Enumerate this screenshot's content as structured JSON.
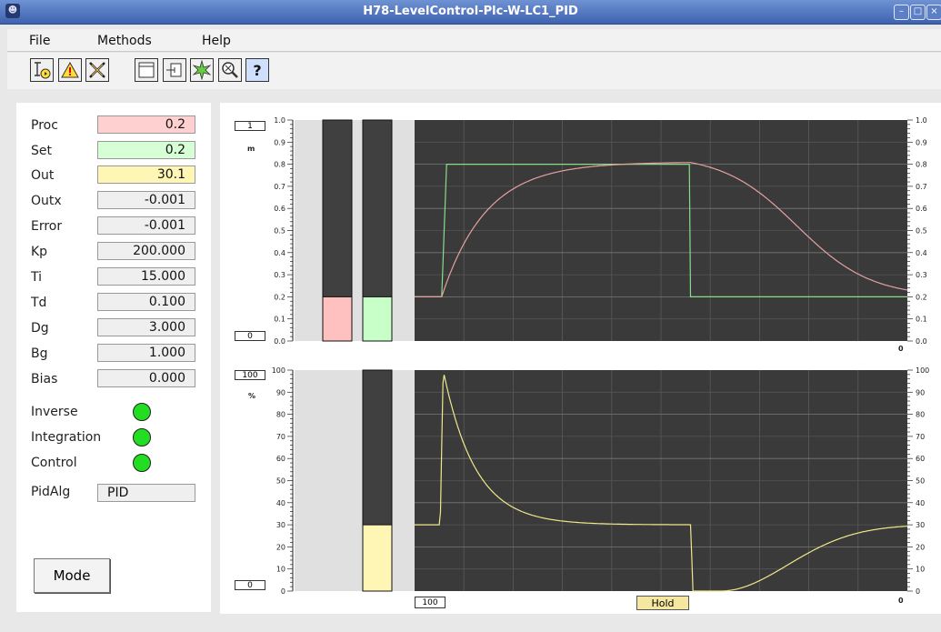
{
  "window": {
    "title": "H78-LevelControl-Plc-W-LC1_PID"
  },
  "menu": [
    "File",
    "Methods",
    "Help"
  ],
  "toolbar": [
    "graph-icon",
    "event-icon",
    "block-icon",
    "object-icon",
    "classgraph-icon",
    "crossref-icon",
    "help-icon"
  ],
  "params": [
    {
      "label": "Proc",
      "value": "0.2"
    },
    {
      "label": "Set",
      "value": "0.2"
    },
    {
      "label": "Out",
      "value": "30.1"
    },
    {
      "label": "Outx",
      "value": "-0.001"
    },
    {
      "label": "Error",
      "value": "-0.001"
    },
    {
      "label": "Kp",
      "value": "200.000"
    },
    {
      "label": "Ti",
      "value": "15.000"
    },
    {
      "label": "Td",
      "value": "0.100"
    },
    {
      "label": "Dg",
      "value": "3.000"
    },
    {
      "label": "Bg",
      "value": "1.000"
    },
    {
      "label": "Bias",
      "value": "0.000"
    }
  ],
  "flags": [
    {
      "label": "Inverse",
      "state": "on"
    },
    {
      "label": "Integration",
      "state": "on"
    },
    {
      "label": "Control",
      "state": "on"
    }
  ],
  "pidalg": {
    "label": "PidAlg",
    "value": "PID"
  },
  "mode_label": "Mode",
  "colors": {
    "proc": "#ffc0c0",
    "set": "#c8ffc8",
    "out": "#fff5b4",
    "led": "#22dd22",
    "trend_bg": "#3a3a3a"
  },
  "upper": {
    "max_box": "1",
    "min_box": "0",
    "unit": "m",
    "scale_labels": [
      "1.0",
      "0.9",
      "0.8",
      "0.7",
      "0.6",
      "0.5",
      "0.4",
      "0.3",
      "0.2",
      "0.1",
      "0.0"
    ],
    "right_scale_labels": [
      "1.0",
      "0.9",
      "0.8",
      "0.7",
      "0.6",
      "0.5",
      "0.4",
      "0.3",
      "0.2",
      "0.1",
      "0.0"
    ],
    "time_label": "0",
    "bars": [
      {
        "name": "Proc",
        "value": 0.2
      },
      {
        "name": "Set",
        "value": 0.2
      }
    ]
  },
  "lower": {
    "max_box": "100",
    "min_box": "0",
    "unit": "%",
    "scale_labels": [
      "100",
      "90",
      "80",
      "70",
      "60",
      "50",
      "40",
      "30",
      "20",
      "10",
      "0"
    ],
    "right_scale_labels": [
      "100",
      "90",
      "80",
      "70",
      "60",
      "50",
      "40",
      "30",
      "20",
      "10",
      "0"
    ],
    "time_label": "0",
    "bars": [
      {
        "name": "Out",
        "value": 30
      }
    ]
  },
  "time_box": "100",
  "hold_label": "Hold"
}
